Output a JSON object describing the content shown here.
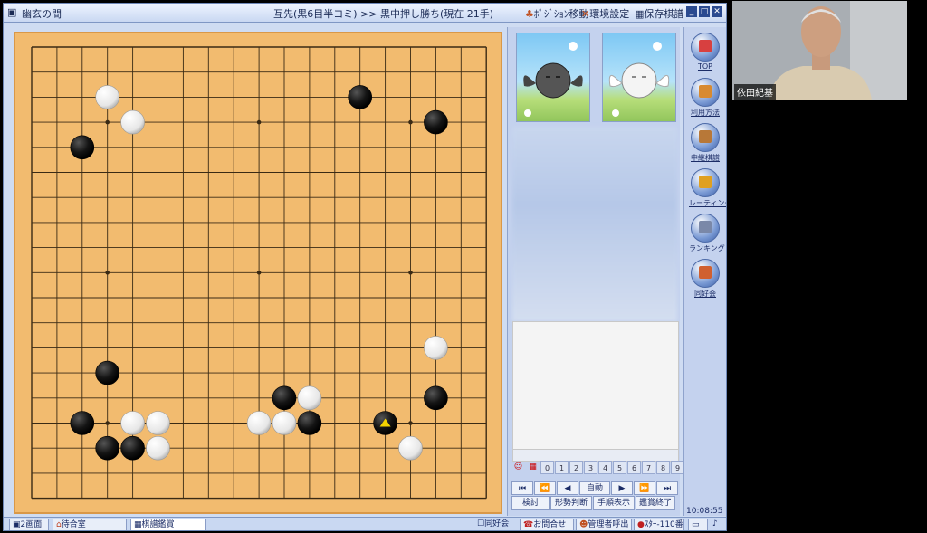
{
  "titlebar": {
    "app_name": "幽玄の間",
    "game_info": "互先(黒6目半コミ) >> 黒中押し勝ち(現在 21手)",
    "btn_move": "ﾎﾟｼﾞｼｮﾝ移動",
    "btn_env": "環境設定",
    "btn_save": "保存棋譜"
  },
  "board": {
    "size": 19,
    "star_points": [
      [
        3,
        3
      ],
      [
        3,
        9
      ],
      [
        3,
        15
      ],
      [
        9,
        3
      ],
      [
        9,
        9
      ],
      [
        9,
        15
      ],
      [
        15,
        3
      ],
      [
        15,
        9
      ],
      [
        15,
        15
      ]
    ],
    "stones": [
      {
        "c": "w",
        "x": 3,
        "y": 2
      },
      {
        "c": "w",
        "x": 4,
        "y": 3
      },
      {
        "c": "b",
        "x": 2,
        "y": 4
      },
      {
        "c": "b",
        "x": 13,
        "y": 2
      },
      {
        "c": "b",
        "x": 16,
        "y": 3
      },
      {
        "c": "w",
        "x": 16,
        "y": 12
      },
      {
        "c": "b",
        "x": 16,
        "y": 14
      },
      {
        "c": "b",
        "x": 3,
        "y": 13
      },
      {
        "c": "b",
        "x": 2,
        "y": 15
      },
      {
        "c": "w",
        "x": 4,
        "y": 15
      },
      {
        "c": "w",
        "x": 5,
        "y": 15
      },
      {
        "c": "b",
        "x": 3,
        "y": 16
      },
      {
        "c": "b",
        "x": 4,
        "y": 16
      },
      {
        "c": "w",
        "x": 5,
        "y": 16
      },
      {
        "c": "b",
        "x": 10,
        "y": 14
      },
      {
        "c": "w",
        "x": 11,
        "y": 14
      },
      {
        "c": "w",
        "x": 9,
        "y": 15
      },
      {
        "c": "w",
        "x": 10,
        "y": 15
      },
      {
        "c": "b",
        "x": 11,
        "y": 15
      },
      {
        "c": "b",
        "x": 14,
        "y": 15
      },
      {
        "c": "w",
        "x": 15,
        "y": 16
      }
    ],
    "last_move": {
      "x": 14,
      "y": 15
    }
  },
  "panel": {
    "move_numbers": [
      "0",
      "1",
      "2",
      "3",
      "4",
      "5",
      "6",
      "7",
      "8",
      "9"
    ],
    "nav": {
      "first": "⏮",
      "prev_fast": "⏪",
      "prev": "◀",
      "auto": "自動",
      "next": "▶",
      "next_fast": "⏩",
      "last": "⏭"
    },
    "actions": {
      "review": "検討",
      "evaluate": "形勢判断",
      "order": "手順表示",
      "end": "鑑賞終了"
    }
  },
  "rightbar": [
    {
      "label": "TOP",
      "color": "#d84040"
    },
    {
      "label": "利用方法",
      "color": "#d88a30"
    },
    {
      "label": "中継棋譜",
      "color": "#b87838"
    },
    {
      "label": "レーティング",
      "color": "#e0a020"
    },
    {
      "label": "ランキング",
      "color": "#7a88a8"
    },
    {
      "label": "同好会",
      "color": "#d06030"
    }
  ],
  "clock": "10:08:55",
  "taskbar": {
    "screens": "2画面",
    "waiting_room": "待合室",
    "kifu": "棋譜鑑賞",
    "club": "同好会",
    "inquiry": "お問合せ",
    "admin": "管理者呼出",
    "seat": "ｽﾀｰ-110番"
  },
  "video": {
    "name": "依田紀基"
  },
  "colors": {
    "board": "#f2bb6f",
    "line": "#3a2a14",
    "black": "#141414",
    "white": "#f7f7f7",
    "marker": "#f5d400"
  }
}
